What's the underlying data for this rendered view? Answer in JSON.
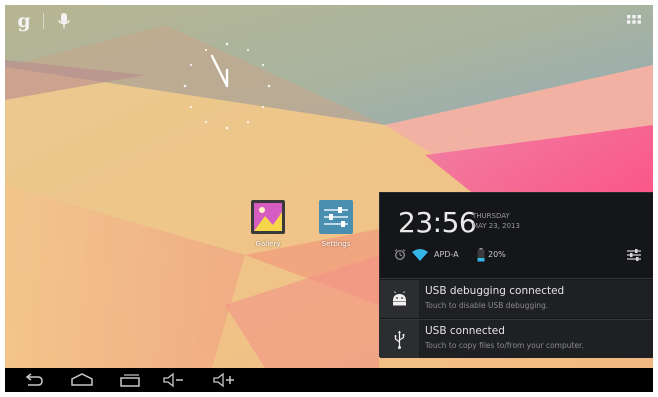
{
  "icons": {
    "search": "google-search-icon",
    "voice": "microphone-icon",
    "apps": "all-apps-icon"
  },
  "shortcuts": [
    {
      "label": "Gallery",
      "icon": "gallery-icon"
    },
    {
      "label": "Settings",
      "icon": "settings-sliders-icon"
    }
  ],
  "shade": {
    "time": "23:56",
    "weekday": "THURSDAY",
    "date": "MAY 23, 2013",
    "wifi_name": "APD-A",
    "battery": "20%",
    "notifications": [
      {
        "title": "USB debugging connected",
        "subtitle": "Touch to disable USB debugging.",
        "icon": "android-debug-icon"
      },
      {
        "title": "USB connected",
        "subtitle": "Touch to copy files to/from your computer.",
        "icon": "usb-icon"
      }
    ]
  },
  "navbar": {
    "buttons": [
      "back-icon",
      "home-icon",
      "recent-apps-icon",
      "volume-down-icon",
      "volume-up-icon"
    ]
  },
  "colors": {
    "accent_blue": "#33b5e5",
    "shade_bg": "#151619",
    "navbar_bg": "#000000"
  }
}
